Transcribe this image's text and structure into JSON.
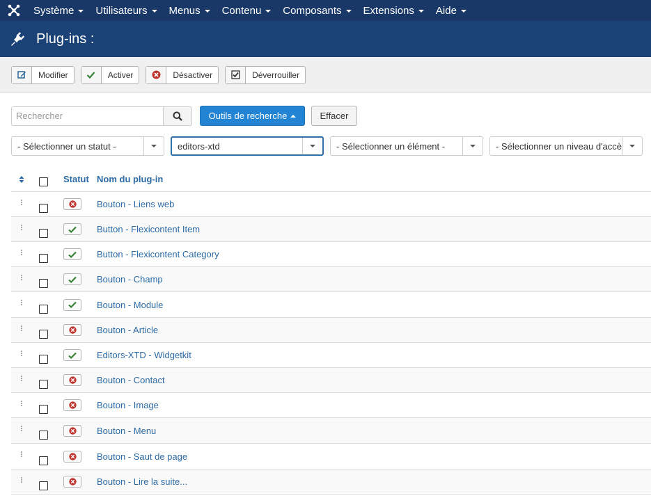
{
  "navbar": {
    "items": [
      "Système",
      "Utilisateurs",
      "Menus",
      "Contenu",
      "Composants",
      "Extensions",
      "Aide"
    ]
  },
  "header": {
    "title": "Plug-ins :"
  },
  "toolbar": {
    "modifier": "Modifier",
    "activer": "Activer",
    "desactiver": "Désactiver",
    "deverrouiller": "Déverrouiller"
  },
  "search": {
    "placeholder": "Rechercher",
    "tools_label": "Outils de recherche",
    "clear_label": "Effacer"
  },
  "filters": {
    "status": "- Sélectionner un statut -",
    "type": "editors-xtd",
    "element": "- Sélectionner un élément -",
    "access": "- Sélectionner un niveau d'accès -"
  },
  "table": {
    "columns": {
      "status": "Statut",
      "name": "Nom du plug-in"
    },
    "rows": [
      {
        "name": "Bouton - Liens web",
        "enabled": false
      },
      {
        "name": "Button - Flexicontent Item",
        "enabled": true
      },
      {
        "name": "Button - Flexicontent Category",
        "enabled": true
      },
      {
        "name": "Bouton - Champ",
        "enabled": true
      },
      {
        "name": "Bouton - Module",
        "enabled": true
      },
      {
        "name": "Bouton - Article",
        "enabled": false
      },
      {
        "name": "Editors-XTD - Widgetkit",
        "enabled": true
      },
      {
        "name": "Bouton - Contact",
        "enabled": false
      },
      {
        "name": "Bouton - Image",
        "enabled": false
      },
      {
        "name": "Bouton - Menu",
        "enabled": false
      },
      {
        "name": "Bouton - Saut de page",
        "enabled": false
      },
      {
        "name": "Bouton - Lire la suite...",
        "enabled": false
      }
    ]
  },
  "colors": {
    "navbar": "#1a3867",
    "header": "#1b4276",
    "primary": "#2384d3",
    "enabled": "#378137",
    "disabled": "#bd362f",
    "link": "#2d6aa3"
  }
}
